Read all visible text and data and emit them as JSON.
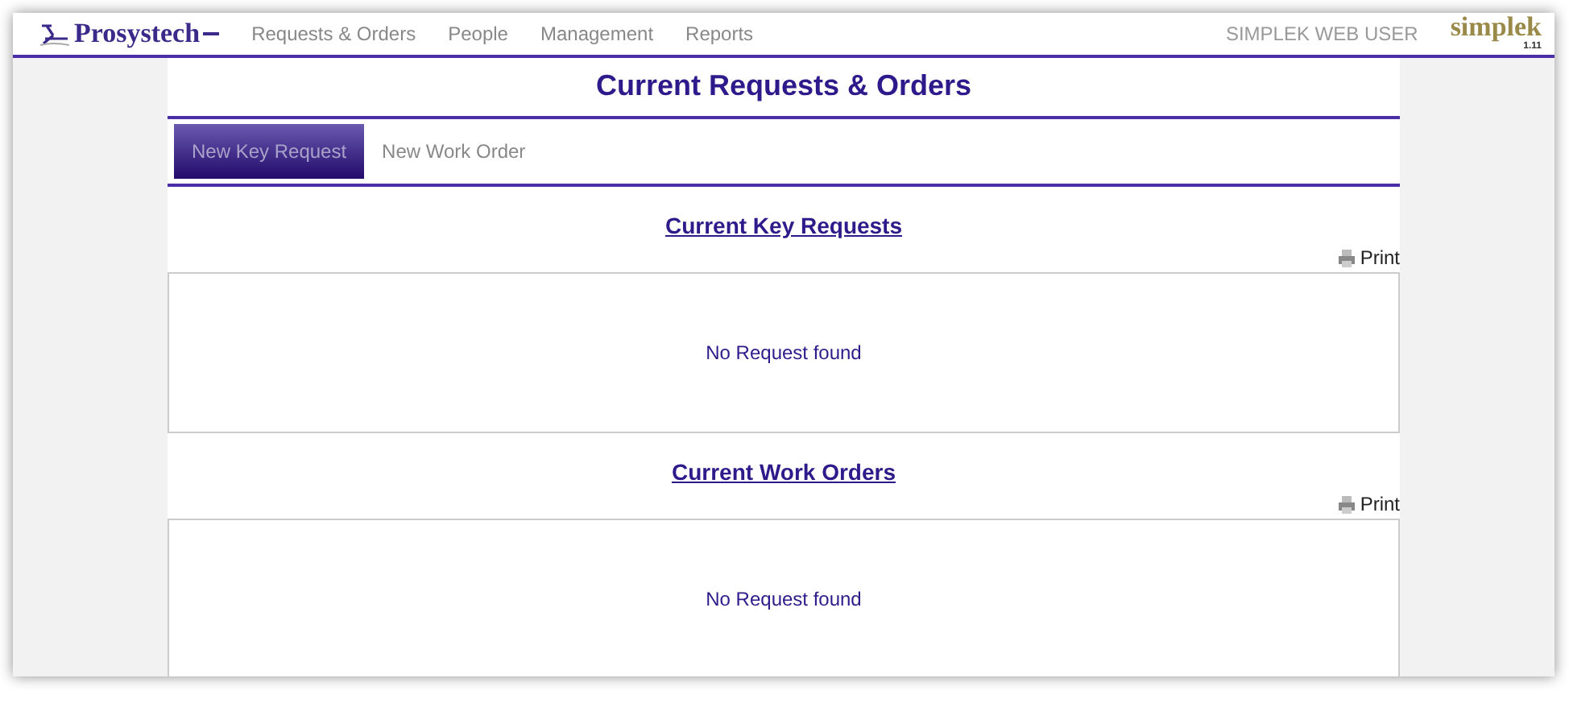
{
  "header": {
    "logo": "Prosystech",
    "nav": [
      {
        "label": "Requests & Orders",
        "selected": false
      },
      {
        "label": "People",
        "selected": false
      },
      {
        "label": "Management",
        "selected": false
      },
      {
        "label": "Reports",
        "selected": false
      }
    ],
    "user": "SIMPLEK WEB USER",
    "brand": "simplek",
    "version": "1.11"
  },
  "page_title": "Current Requests & Orders",
  "tabs": [
    {
      "label": "New Key Request",
      "selected": true
    },
    {
      "label": "New Work Order",
      "selected": false
    }
  ],
  "sections": [
    {
      "title": "Current Key Requests",
      "print": "Print",
      "empty_message": "No Request found"
    },
    {
      "title": "Current Work Orders",
      "print": "Print",
      "empty_message": "No Request found"
    }
  ]
}
